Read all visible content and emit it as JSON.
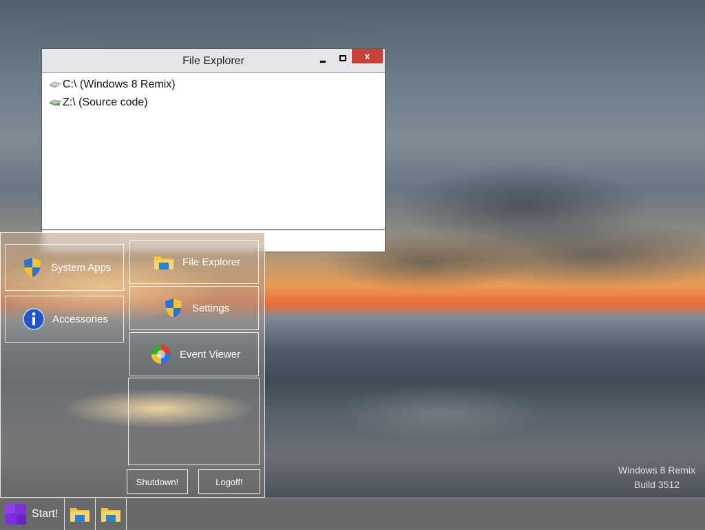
{
  "file_explorer": {
    "title": "File Explorer",
    "close_glyph": "x",
    "drives": [
      {
        "label": "C:\\ (Windows 8 Remix)",
        "icon": "hard-drive-icon"
      },
      {
        "label": "Z:\\ (Source code)",
        "icon": "network-drive-icon"
      }
    ]
  },
  "start_menu": {
    "left_tiles": [
      {
        "label": "System Apps",
        "icon": "shield-icon"
      },
      {
        "label": "Accessories",
        "icon": "info-icon"
      }
    ],
    "right_tiles": [
      {
        "label": "File Explorer",
        "icon": "folder-icon"
      },
      {
        "label": "Settings",
        "icon": "shield-icon"
      },
      {
        "label": "Event Viewer",
        "icon": "event-viewer-icon"
      }
    ],
    "shutdown_label": "Shutdown!",
    "logoff_label": "Logoff!"
  },
  "taskbar": {
    "start_label": "Start!",
    "apps": [
      {
        "name": "File Explorer",
        "icon": "folder-icon"
      },
      {
        "name": "File Explorer",
        "icon": "folder-icon"
      }
    ]
  },
  "watermark": {
    "line1": "Windows 8 Remix",
    "line2": "Build 3512"
  },
  "colors": {
    "close_button": "#c9403a",
    "start_logo": "#7b2fd6"
  }
}
